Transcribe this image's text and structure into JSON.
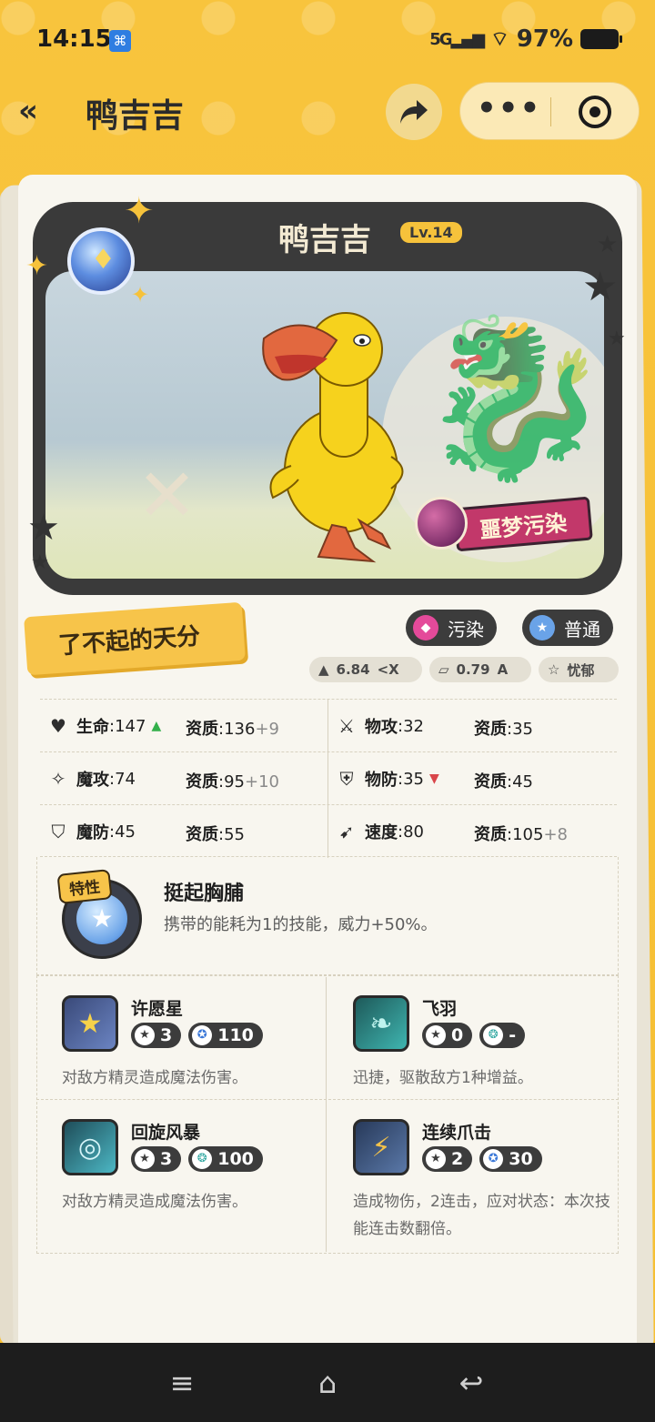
{
  "status_bar": {
    "time": "14:15",
    "network": "5G",
    "battery": "97%",
    "icons": [
      "app-notification-icon",
      "signal-icon",
      "wifi-icon",
      "battery-icon"
    ]
  },
  "header": {
    "title": "鸭吉吉",
    "icons": [
      "back-double-chevron-icon",
      "share-icon",
      "more-dots-icon",
      "target-icon"
    ]
  },
  "pet": {
    "name": "鸭吉吉",
    "level": "Lv.14",
    "status_badge": "噩梦污染",
    "element_icon": "element-orb-icon"
  },
  "talent": {
    "label": "了不起的天分"
  },
  "tags": [
    {
      "label": "污染",
      "icon": "pollution-icon",
      "color": "#e44a9a"
    },
    {
      "label": "普通",
      "icon": "normal-star-icon",
      "color": "#6aa3e8"
    }
  ],
  "mini_stats": [
    {
      "value": "6.84",
      "unit": "<X",
      "icon": "weight-icon"
    },
    {
      "value": "0.79",
      "unit": "A",
      "icon": "ruler-icon"
    },
    {
      "value": "忧郁",
      "icon": "personality-star-icon"
    }
  ],
  "stats": [
    {
      "name": "生命",
      "value": "147",
      "trend": "up",
      "aptitude": "136",
      "bonus": "+9",
      "icon": "heart-icon"
    },
    {
      "name": "物攻",
      "value": "32",
      "trend": "",
      "aptitude": "35",
      "bonus": "",
      "icon": "sword-icon"
    },
    {
      "name": "魔攻",
      "value": "74",
      "trend": "",
      "aptitude": "95",
      "bonus": "+10",
      "icon": "magic-wand-icon"
    },
    {
      "name": "物防",
      "value": "35",
      "trend": "down",
      "aptitude": "45",
      "bonus": "",
      "icon": "shield-icon"
    },
    {
      "name": "魔防",
      "value": "45",
      "trend": "",
      "aptitude": "55",
      "bonus": "",
      "icon": "magic-shield-icon"
    },
    {
      "name": "速度",
      "value": "80",
      "trend": "",
      "aptitude": "105",
      "bonus": "+8",
      "icon": "boot-icon"
    }
  ],
  "aptitude_label": "资质",
  "trait": {
    "tag": "特性",
    "name": "挺起胸脯",
    "description": "携带的能耗为1的技能，威力+50%。"
  },
  "skills": [
    {
      "name": "许愿星",
      "cost": "3",
      "power": "110",
      "power_icon": "magic-power-icon",
      "description": "对敌方精灵造成魔法伤害。",
      "icon": "wish-star-icon"
    },
    {
      "name": "飞羽",
      "cost": "0",
      "power": "-",
      "power_icon": "status-power-icon",
      "description": "迅捷，驱散敌方1种增益。",
      "icon": "feather-icon"
    },
    {
      "name": "回旋风暴",
      "cost": "3",
      "power": "100",
      "power_icon": "status-power-icon",
      "description": "对敌方精灵造成魔法伤害。",
      "icon": "whirlwind-icon"
    },
    {
      "name": "连续爪击",
      "cost": "2",
      "power": "30",
      "power_icon": "magic-power-icon",
      "description": "造成物伤，2连击，应对状态：本次技能连击数翻倍。",
      "icon": "claw-icon"
    }
  ],
  "nav": {
    "icons": [
      "menu-icon",
      "home-icon",
      "back-icon"
    ]
  }
}
